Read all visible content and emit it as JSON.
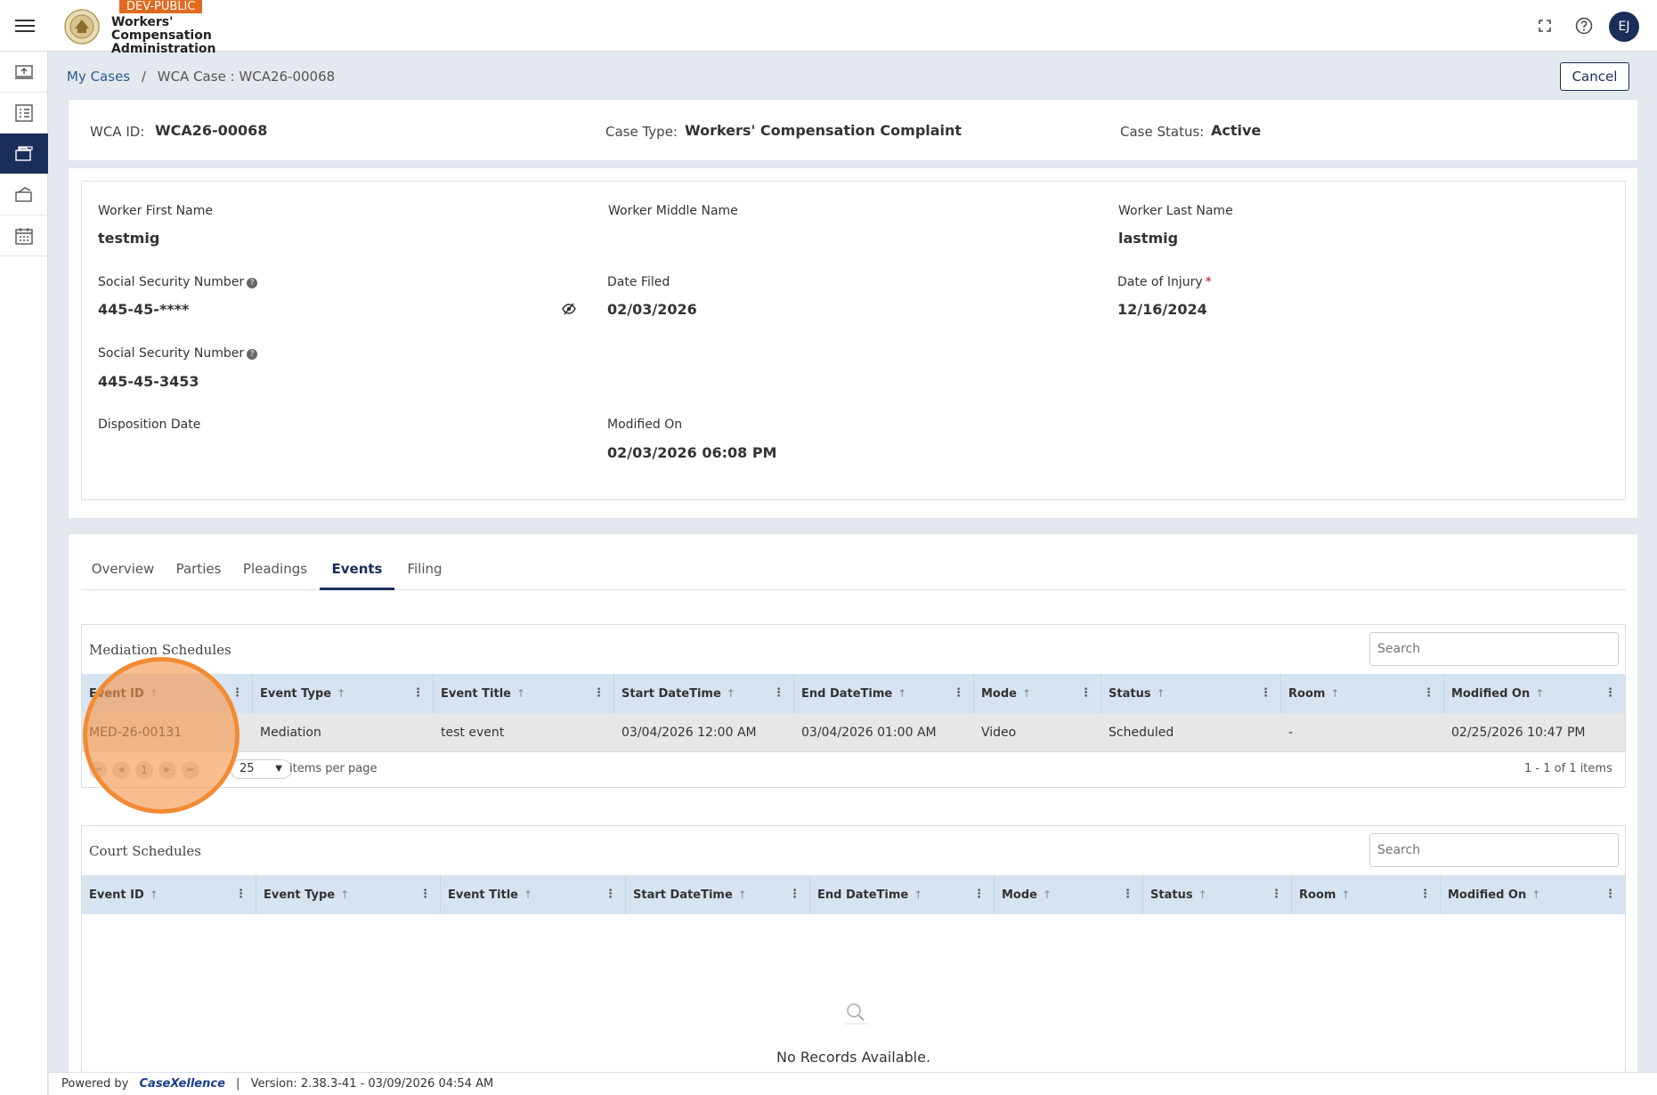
{
  "header": {
    "env_badge": "DEV-PUBLIC",
    "org_line1": "Workers'",
    "org_line2": "Compensation",
    "org_line3": "Administration",
    "user_initials": "EJ",
    "icons": [
      "menu-icon",
      "fullscreen-icon",
      "help-icon"
    ]
  },
  "rail": {
    "items": [
      "upload-icon",
      "checklist-icon",
      "briefcase-icon",
      "gavel-icon",
      "calendar-icon"
    ],
    "active_index": 2
  },
  "breadcrumb": {
    "root": "My Cases",
    "separator": "/",
    "current": "WCA Case : WCA26-00068"
  },
  "actions": {
    "cancel": "Cancel"
  },
  "summary": {
    "wca_id_label": "WCA ID:",
    "wca_id": "WCA26-00068",
    "case_type_label": "Case Type:",
    "case_type": "Workers' Compensation Complaint",
    "case_status_label": "Case Status:",
    "case_status": "Active"
  },
  "details": {
    "first_name_label": "Worker First Name",
    "first_name": "testmig",
    "middle_name_label": "Worker Middle Name",
    "last_name_label": "Worker Last Name",
    "last_name": "lastmig",
    "ssn_label": "Social Security Number",
    "ssn_masked": "445-45-****",
    "date_filed_label": "Date Filed",
    "date_filed": "02/03/2026",
    "doi_label": "Date of Injury",
    "doi_required": "*",
    "doi": "12/16/2024",
    "ssn2_label": "Social Security Number",
    "ssn_full": "445-45-3453",
    "disposition_label": "Disposition Date",
    "modified_label": "Modified On",
    "modified": "02/03/2026 06:08 PM"
  },
  "tabs": [
    "Overview",
    "Parties",
    "Pleadings",
    "Events",
    "Filing"
  ],
  "active_tab": "Events",
  "mediation": {
    "title": "Mediation Schedules",
    "search_placeholder": "Search",
    "columns": [
      "Event ID",
      "Event Type",
      "Event Title",
      "Start DateTime",
      "End DateTime",
      "Mode",
      "Status",
      "Room",
      "Modified On"
    ],
    "rows": [
      [
        "MED-26-00131",
        "Mediation",
        "test event",
        "03/04/2026 12:00 AM",
        "03/04/2026 01:00 AM",
        "Video",
        "Scheduled",
        "-",
        "02/25/2026 10:47 PM"
      ]
    ],
    "pager": {
      "current_page": "1",
      "page_size": "25",
      "page_size_label": "items per page",
      "summary": "1 - 1 of 1 items"
    }
  },
  "court": {
    "title": "Court Schedules",
    "search_placeholder": "Search",
    "columns": [
      "Event ID",
      "Event Type",
      "Event Title",
      "Start DateTime",
      "End DateTime",
      "Mode",
      "Status",
      "Room",
      "Modified On"
    ],
    "empty_text": "No Records Available."
  },
  "footer": {
    "powered_by": "Powered by",
    "brand": "CaseXellence",
    "separator": "|",
    "version": "Version: 2.38.3-41 - 03/09/2026 04:54 AM"
  },
  "colors": {
    "navy": "#1a2e5a",
    "badge_orange": "#e06a1f",
    "grid_header": "#d6e4f2",
    "click_highlight": "#f28b34"
  }
}
